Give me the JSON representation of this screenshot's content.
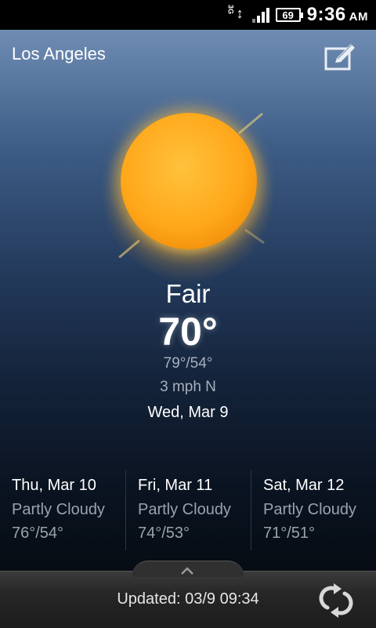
{
  "status_bar": {
    "network": "3G",
    "battery_level": "69",
    "time": "9:36",
    "ampm": "AM"
  },
  "location": {
    "city": "Los Angeles"
  },
  "current": {
    "condition": "Fair",
    "temperature": "70°",
    "hi_lo": "79°/54°",
    "wind": "3 mph N",
    "date": "Wed, Mar 9",
    "icon": "sun-icon"
  },
  "forecast": [
    {
      "day": "Thu, Mar 10",
      "condition": "Partly Cloudy",
      "temps": "76°/54°"
    },
    {
      "day": "Fri, Mar 11",
      "condition": "Partly Cloudy",
      "temps": "74°/53°"
    },
    {
      "day": "Sat, Mar 12",
      "condition": "Partly Cloudy",
      "temps": "71°/51°"
    }
  ],
  "footer": {
    "updated": "Updated: 03/9 09:34"
  },
  "colors": {
    "sun": "#ffa71a",
    "sky_top": "#6f8db3",
    "sky_bottom": "#070c14"
  }
}
